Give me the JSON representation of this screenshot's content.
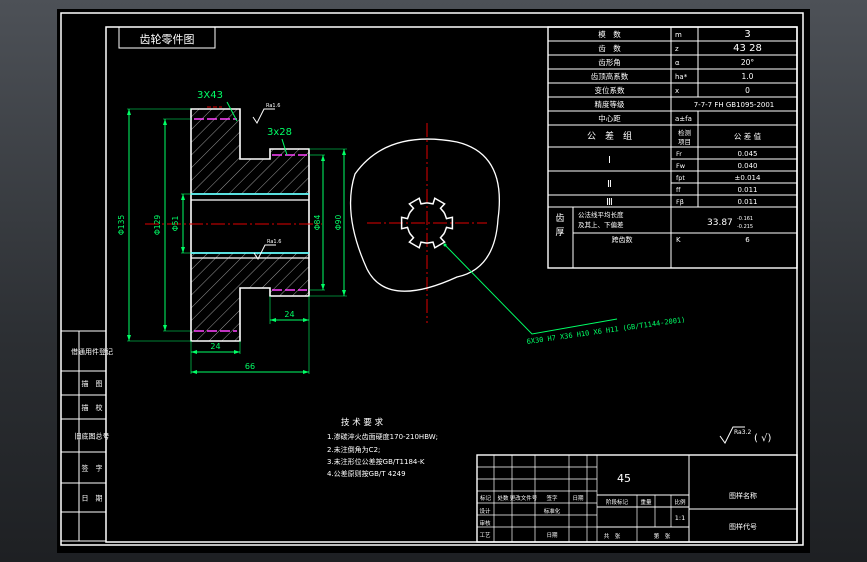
{
  "title_tag": "齿轮零件图",
  "spec_table": {
    "rows": [
      {
        "label": "模　数",
        "sym": "m",
        "value": "3"
      },
      {
        "label": "齿　数",
        "sym": "z",
        "value": "43 28"
      },
      {
        "label": "齿形角",
        "sym": "α",
        "value": "20°"
      },
      {
        "label": "齿顶高系数",
        "sym": "ha*",
        "value": "1.0"
      },
      {
        "label": "变位系数",
        "sym": "x",
        "value": "0"
      },
      {
        "label": "精度等级",
        "sym": "",
        "value": "7-7-7 FH GB1095-2001"
      },
      {
        "label": "中心距",
        "sym": "a±fa",
        "value": ""
      }
    ],
    "group_header": {
      "label": "公　差　组",
      "col2": "检测项目",
      "col3": "公 差 值"
    },
    "groups": [
      {
        "name": "Ⅰ",
        "items": [
          {
            "sym": "Fr",
            "value": "0.045"
          },
          {
            "sym": "Fw",
            "value": "0.040"
          }
        ]
      },
      {
        "name": "Ⅱ",
        "items": [
          {
            "sym": "fpt",
            "value": "±0.014"
          },
          {
            "sym": "ff",
            "value": "0.011"
          }
        ]
      },
      {
        "name": "Ⅲ",
        "items": [
          {
            "sym": "Fβ",
            "value": "0.011"
          }
        ]
      }
    ],
    "thickness": {
      "label": "齿厚",
      "desc1": "公法线平均长度",
      "desc2": "及其上、下偏差",
      "value": "33.87",
      "dev_up": "-0.161",
      "dev_low": "-0.215"
    },
    "span": {
      "label": "跨齿数",
      "sym": "K",
      "value": "6"
    }
  },
  "dimensions": {
    "teeth_large": "3X43",
    "teeth_small": "3x28",
    "rough1": "Ra1.6",
    "rough2": "Ra1.6",
    "d135": "Φ135",
    "d129": "Φ129",
    "d51": "Φ51",
    "d84": "Φ84",
    "d90": "Φ90",
    "w24a": "24",
    "w24b": "24",
    "len66": "66",
    "spline": "6X30 H7 X36 H10 X6 H11 (GB/T1144-2001)"
  },
  "notes": {
    "title": "技 术 要 求",
    "items": [
      "1.渗碳淬火齿面硬度170-210HBW;",
      "2.未注倒角为C2;",
      "3.未注形位公差按GB/T1184-K",
      "4.公差原则按GB/T 4249"
    ]
  },
  "surface_finish": {
    "ra": "Ra3.2",
    "check": "( √)"
  },
  "side_labels": [
    "借通用件登记",
    "描　图",
    "描　校",
    "旧底图总号",
    "签　字",
    "日　期"
  ],
  "title_block": {
    "material": "45",
    "company": "图样名称",
    "drawing_no": "图样代号",
    "h_cols": [
      "标记",
      "处数",
      "更改文件号",
      "签字",
      "日期"
    ],
    "row_labels": [
      "设计",
      "审核",
      "工艺"
    ],
    "std_label": "标准化",
    "date_label": "日期",
    "stage_label": "阶段标记",
    "weight_label": "重量",
    "scale_label": "比例",
    "scale_value": "1:1",
    "sheet_total": "共　张",
    "sheet_no": "第　张"
  },
  "colors": {
    "frame": "#ffffff",
    "part": "#ffffff",
    "dim": "#00ff66",
    "center": "#e00000",
    "thread": "#ff44ff",
    "bore": "#66ffff",
    "hatch": "#ffffff"
  }
}
